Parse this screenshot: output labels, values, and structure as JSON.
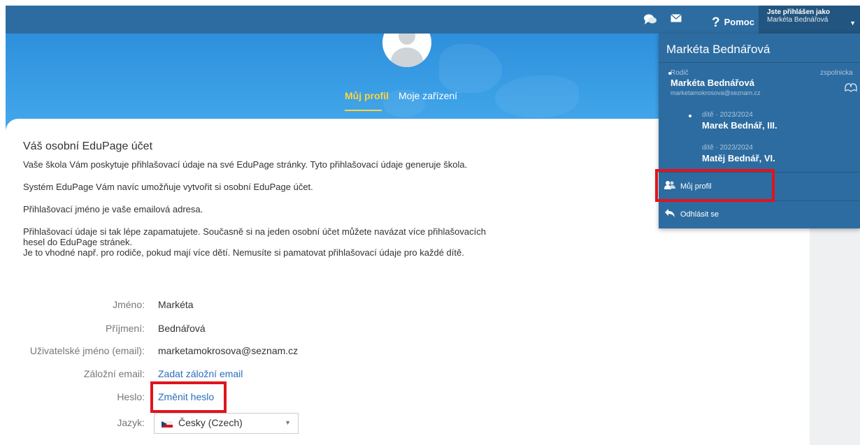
{
  "topbar": {
    "help_label": "Pomoc",
    "help_mark": "?",
    "user_line1": "Jste přihlášen jako",
    "user_line2": "Markéta Bednářová"
  },
  "hero": {
    "tabs": [
      {
        "label": "Můj profil",
        "active": true
      },
      {
        "label": "Moje zařízení",
        "active": false
      }
    ]
  },
  "content": {
    "heading": "Váš osobní EduPage účet",
    "paragraphs": [
      "Vaše škola Vám poskytuje přihlašovací údaje na své EduPage stránky. Tyto přihlašovací údaje generuje škola.",
      "Systém EduPage Vám navíc umožňuje vytvořit si osobní EduPage účet.",
      "Přihlašovací jméno je vaše emailová adresa.",
      "Přihlašovací údaje si tak lépe zapamatujete. Současně si na jeden osobní účet můžete navázat více přihlašovacích hesel do EduPage stránek.",
      "Je to vhodné např. pro rodiče, pokud mají více dětí. Nemusíte si pamatovat přihlašovací údaje pro každé dítě."
    ]
  },
  "form": {
    "first_name_label": "Jméno:",
    "first_name_value": "Markéta",
    "last_name_label": "Příjmení:",
    "last_name_value": "Bednářová",
    "username_label": "Uživatelské jméno (email):",
    "username_value": "marketamokrosova@seznam.cz",
    "backup_email_label": "Záložní email:",
    "backup_email_link": "Zadat záložní email",
    "password_label": "Heslo:",
    "password_link": "Změnit heslo",
    "language_label": "Jazyk:",
    "language_value": "Česky (Czech)"
  },
  "panel": {
    "name": "Markéta Bednářová",
    "role": "Rodič",
    "account_name": "Markéta Bednářová",
    "account_email": "marketamokrosova@seznam.cz",
    "school": "zspolnicka",
    "children": [
      {
        "meta": "dítě · 2023/2024",
        "name": "Marek Bednář, III."
      },
      {
        "meta": "dítě · 2023/2024",
        "name": "Matěj Bednář, VI."
      }
    ],
    "menu": [
      {
        "label": "Můj profil",
        "icon": "users-icon"
      },
      {
        "label": "Odhlásit se",
        "icon": "logout-arrow-icon"
      }
    ]
  },
  "colors": {
    "topbar": "#2d6ca0",
    "hero": "#3b9fe6",
    "accent_tab": "#ffd43b",
    "link": "#2a6fbb",
    "highlight": "#e0141e"
  }
}
